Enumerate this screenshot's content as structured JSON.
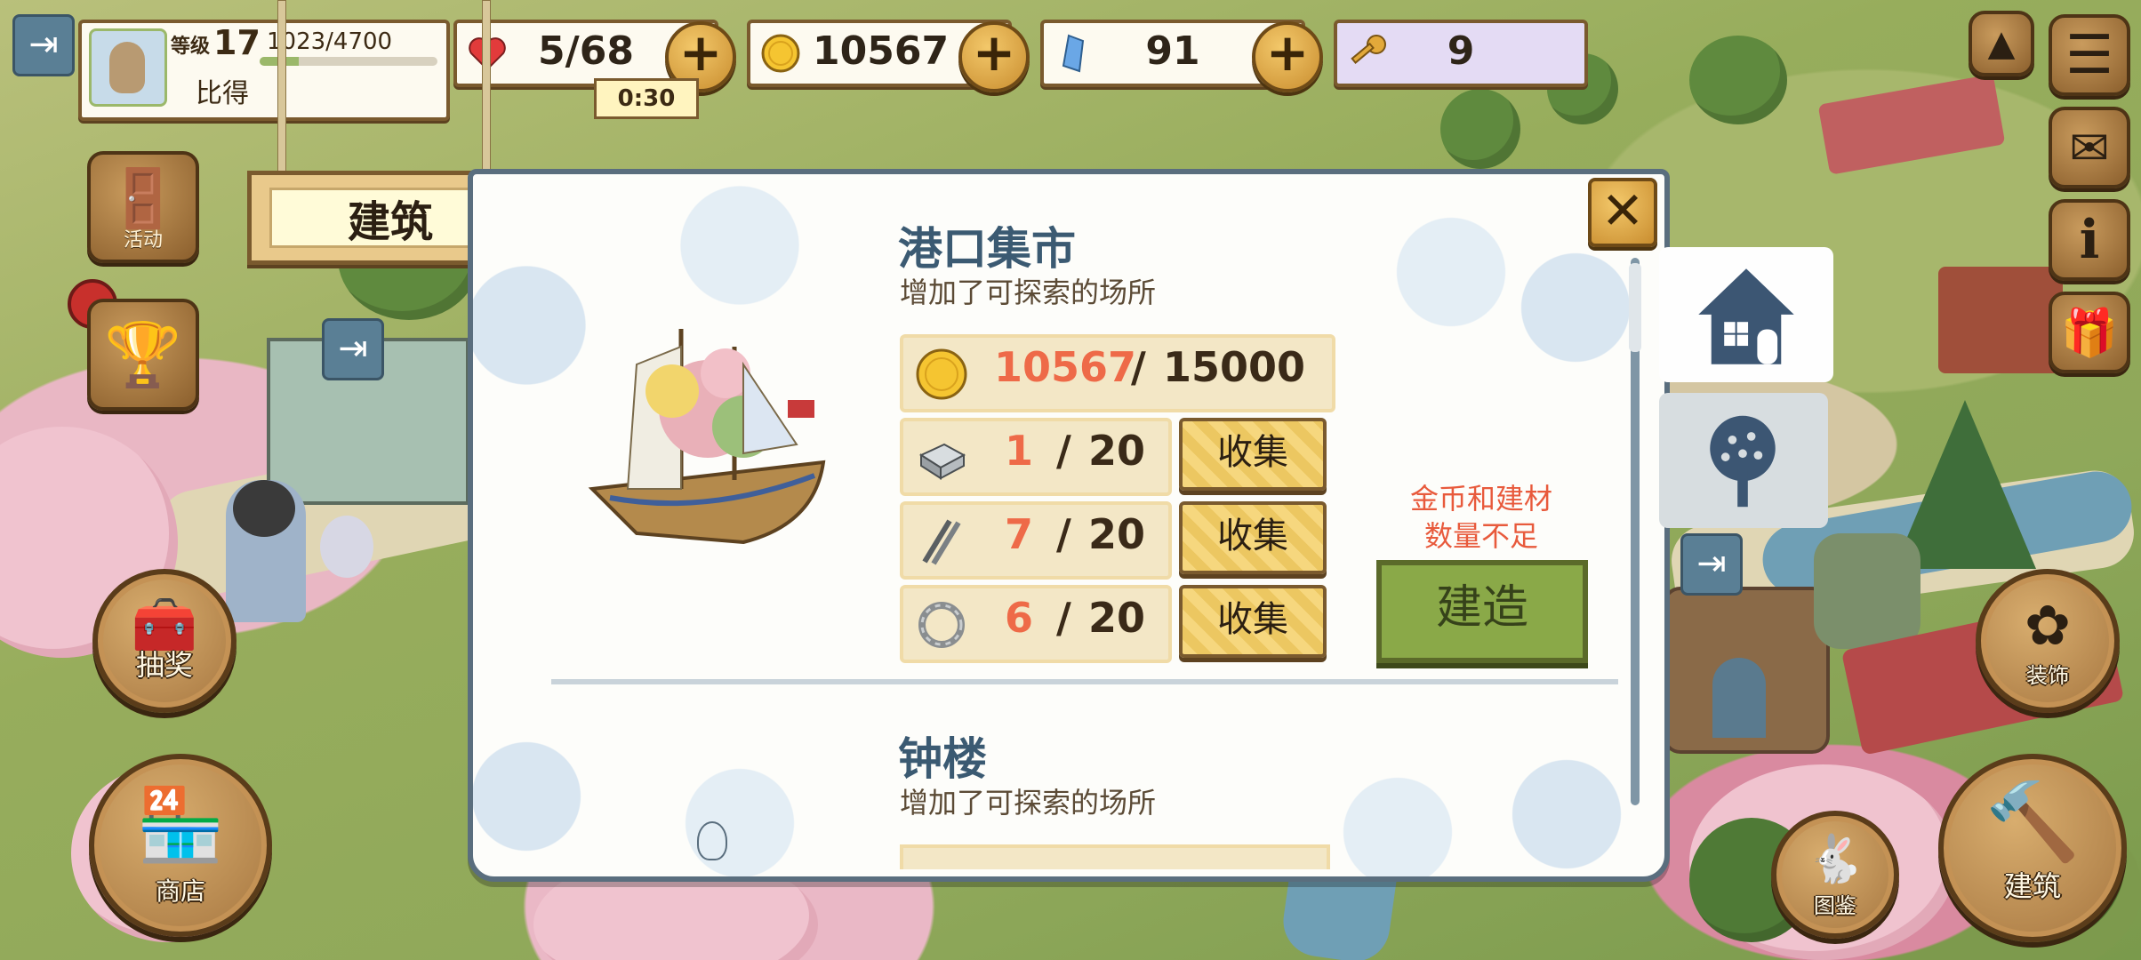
{
  "player": {
    "level_label": "等级",
    "level": "17",
    "xp_text": "1023/4700",
    "xp_fraction": 0.218,
    "name": "比得"
  },
  "resources": {
    "hearts": "5/68",
    "coins": "10567",
    "gems": "91",
    "keys": "9",
    "heart_timer": "0:30"
  },
  "left_menu": {
    "event_label": "活动",
    "lottery_label": "抽奖",
    "shop_label": "商店"
  },
  "right_menu": {
    "decor_label": "装饰",
    "catalog_label": "图鉴",
    "build_label": "建筑"
  },
  "sign": {
    "title": "建筑"
  },
  "buildings": [
    {
      "name": "港口集市",
      "description": "增加了可探索的场所",
      "coin_have": "10567",
      "coin_need": "15000",
      "materials": [
        {
          "icon": "stone-block-icon",
          "have": "1",
          "need": "20",
          "button": "收集"
        },
        {
          "icon": "nails-icon",
          "have": "7",
          "need": "20",
          "button": "收集"
        },
        {
          "icon": "rope-ring-icon",
          "have": "6",
          "need": "20",
          "button": "收集"
        }
      ],
      "warning": "金币和建材数量不足",
      "warning_line1": "金币和建材",
      "warning_line2": "数量不足",
      "build_button": "建造"
    },
    {
      "name": "钟楼",
      "description": "增加了可探索的场所"
    }
  ],
  "slash": "/",
  "colors": {
    "shortage_red": "#ee6a48",
    "title_blue": "#3b5a72",
    "build_green": "#8aa948",
    "wood_brown": "#7a5a2e"
  }
}
